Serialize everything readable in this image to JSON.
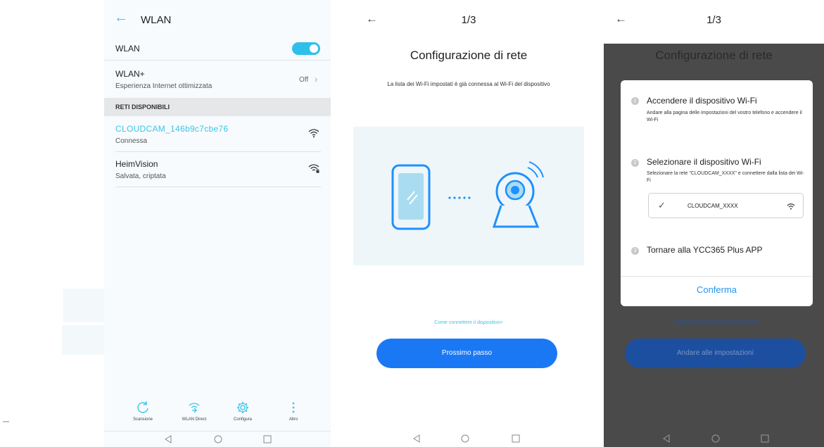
{
  "panel1": {
    "title": "WLAN",
    "wlan_label": "WLAN",
    "wlan_enabled": true,
    "wlan_plus_label": "WLAN+",
    "wlan_plus_sub": "Esperienza Internet ottimizzata",
    "wlan_plus_state": "Off",
    "section_label": "RETI DISPONIBILI",
    "networks": [
      {
        "name": "CLOUDCAM_146b9c7cbe76",
        "status": "Connessa",
        "icon": "wifi-icon"
      },
      {
        "name": "HeimVision",
        "status": "Salvata, criptata",
        "icon": "wifi-lock-icon"
      }
    ],
    "tools": [
      {
        "label": "Scansione",
        "icon": "refresh-icon"
      },
      {
        "label": "WLAN Direct",
        "icon": "wifi-direct-icon"
      },
      {
        "label": "Configura",
        "icon": "gear-icon"
      },
      {
        "label": "Altro",
        "icon": "more-icon"
      }
    ]
  },
  "panel2": {
    "step": "1/3",
    "title": "Configurazione di rete",
    "description": "La lista dei Wi-Fi impostati è già connessa al Wi-Fi del dispositivo",
    "help_link": "Come connettere il dispositivo>",
    "next_button": "Prossimo passo"
  },
  "panel3": {
    "step": "1/3",
    "title": "Configurazione di rete",
    "background_button": "Andare alle impostazioni",
    "dialog": {
      "steps": [
        {
          "num": "1",
          "title": "Accendere il dispositivo Wi-Fi",
          "text": "Andare alla pagina delle impostazioni del vostro telefono e accendere il Wi-Fi"
        },
        {
          "num": "2",
          "title": "Selezionare il dispositivo Wi-Fi",
          "text": "Selezionare la rete \"CLOUDCAM_XXXX\" e connettere dalla lista dei Wi-Fi"
        },
        {
          "num": "3",
          "title": "Tornare alla YCC365 Plus APP",
          "text": ""
        }
      ],
      "wifi_name": "CLOUDCAM_XXXX",
      "confirm": "Conferma"
    }
  },
  "colors": {
    "accent": "#3dc4e6",
    "primary_button": "#1b78f5",
    "confirm": "#2196f3",
    "overlay": "#4a4a4a"
  }
}
